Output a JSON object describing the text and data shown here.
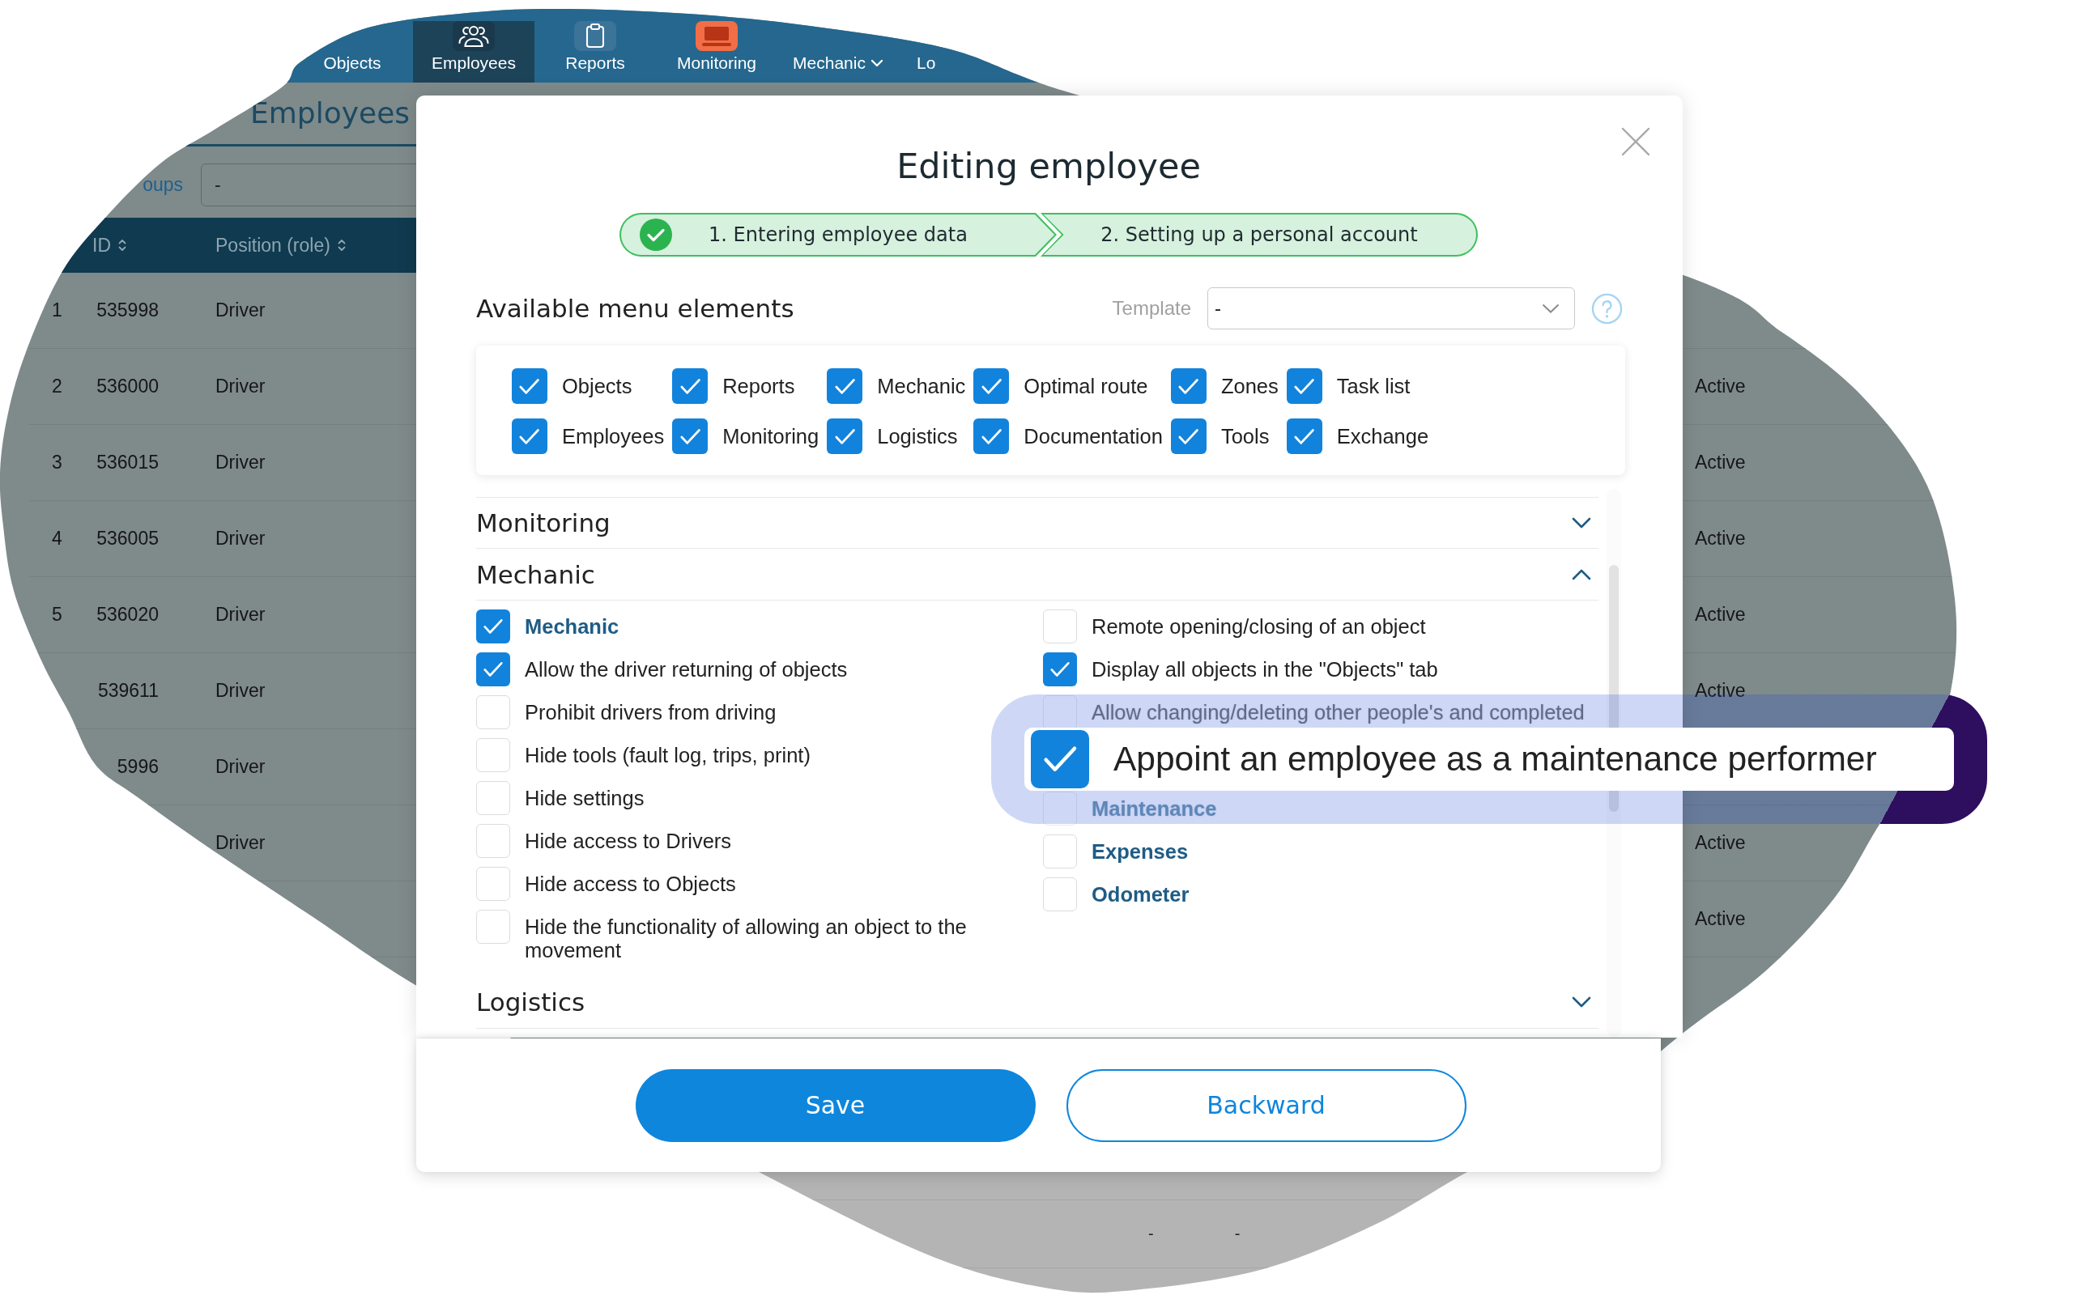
{
  "app": {
    "nav": [
      {
        "label": "Objects",
        "selected": false,
        "dropdown": false
      },
      {
        "label": "Employees",
        "selected": true,
        "dropdown": false
      },
      {
        "label": "Reports",
        "selected": false,
        "dropdown": false
      },
      {
        "label": "Monitoring",
        "selected": false,
        "dropdown": false
      },
      {
        "label": "Mechanic",
        "selected": false,
        "dropdown": true
      },
      {
        "label": "Lo",
        "selected": false,
        "dropdown": false
      }
    ],
    "page_title": "Employees",
    "filter": {
      "label": "oups",
      "value": "-"
    },
    "table": {
      "columns": [
        "ID",
        "Position (role)"
      ],
      "rows": [
        {
          "number": "1",
          "id": "535998",
          "position": "Driver"
        },
        {
          "number": "2",
          "id": "536000",
          "position": "Driver",
          "status": "Active"
        },
        {
          "number": "3",
          "id": "536015",
          "position": "Driver",
          "status": "Active"
        },
        {
          "number": "4",
          "id": "536005",
          "position": "Driver",
          "status": "Active"
        },
        {
          "number": "5",
          "id": "536020",
          "position": "Driver",
          "status": "Active"
        },
        {
          "id": "539611",
          "position": "Driver",
          "status": "Active"
        },
        {
          "id": "5996",
          "position": "Driver"
        },
        {
          "position": "Driver",
          "status": "Active"
        },
        {
          "status": "Active"
        }
      ],
      "bottom_row": [
        "-",
        "-"
      ]
    }
  },
  "dialog": {
    "title": "Editing employee",
    "steps": [
      {
        "label": "1. Entering employee data",
        "completed": true
      },
      {
        "label": "2. Setting up a personal account",
        "completed": false
      }
    ],
    "menu_elements": {
      "title": "Available menu elements",
      "template": {
        "label": "Template",
        "value": "-"
      },
      "items": [
        {
          "label": "Objects",
          "checked": true
        },
        {
          "label": "Reports",
          "checked": true
        },
        {
          "label": "Mechanic",
          "checked": true
        },
        {
          "label": "Optimal route",
          "checked": true
        },
        {
          "label": "Zones",
          "checked": true
        },
        {
          "label": "Task list",
          "checked": true
        },
        {
          "label": "Employees",
          "checked": true
        },
        {
          "label": "Monitoring",
          "checked": true
        },
        {
          "label": "Logistics",
          "checked": true
        },
        {
          "label": "Documentation",
          "checked": true
        },
        {
          "label": "Tools",
          "checked": true
        },
        {
          "label": "Exchange",
          "checked": true
        }
      ]
    },
    "sections": [
      {
        "title": "Monitoring",
        "expanded": false
      },
      {
        "title": "Mechanic",
        "expanded": true,
        "columns": [
          [
            {
              "kind": "group",
              "label": "Mechanic",
              "checked": true,
              "blurred": false
            },
            {
              "kind": "option",
              "label": "Allow the driver returning of objects",
              "checked": true,
              "blurred": false
            },
            {
              "kind": "option",
              "label": "Prohibit drivers from driving",
              "checked": false,
              "blurred": false
            },
            {
              "kind": "option",
              "label": "Hide tools (fault log, trips, print)",
              "checked": false,
              "blurred": false
            },
            {
              "kind": "option",
              "label": "Hide settings",
              "checked": false,
              "blurred": false
            },
            {
              "kind": "option",
              "label": "Hide access to Drivers",
              "checked": false,
              "blurred": false
            },
            {
              "kind": "option",
              "label": "Hide access to Objects",
              "checked": false,
              "blurred": false
            },
            {
              "kind": "option",
              "label": "Hide the functionality of allowing an object to the movement",
              "checked": false,
              "blurred": false
            }
          ],
          [
            {
              "kind": "option",
              "label": "Remote opening/closing of an object",
              "checked": false,
              "blurred": false
            },
            {
              "kind": "option",
              "label": "Display all objects in the \"Objects\" tab",
              "checked": true,
              "blurred": false
            },
            {
              "kind": "option",
              "label": "Allow changing/deleting other people's and completed",
              "checked": false,
              "blurred": true
            },
            {
              "kind": "callout",
              "label": "Appoint an employee as a maintenance performer",
              "checked": true,
              "blurred": false
            },
            {
              "kind": "group",
              "label": "Maintenance",
              "checked": false,
              "blurred": true
            },
            {
              "kind": "group",
              "label": "Expenses",
              "checked": false,
              "blurred": false
            },
            {
              "kind": "group",
              "label": "Odometer",
              "checked": false,
              "blurred": false
            }
          ]
        ]
      },
      {
        "title": "Logistics",
        "expanded": false
      }
    ],
    "buttons": [
      {
        "label": "Save",
        "kind": "primary"
      },
      {
        "label": "Backward",
        "kind": "secondary"
      }
    ]
  }
}
